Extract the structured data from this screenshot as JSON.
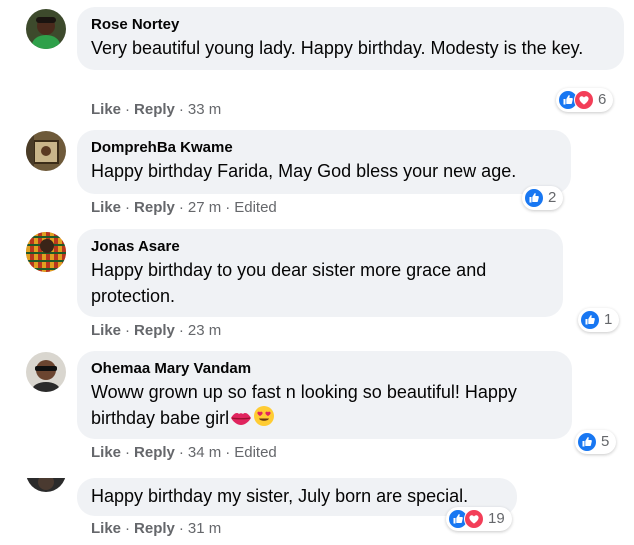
{
  "comments": [
    {
      "author": "Rose Nortey",
      "text": "Very beautiful young lady. Happy birthday. Modesty is the key.",
      "like_label": "Like",
      "reply_label": "Reply",
      "time": "33 m",
      "edited": "",
      "reaction_icons": [
        "like-icon",
        "love-icon"
      ],
      "reaction_count": "6"
    },
    {
      "author": "DomprehBa Kwame",
      "text": "Happy birthday Farida, May God bless your new age.",
      "like_label": "Like",
      "reply_label": "Reply",
      "time": "27 m",
      "edited": "Edited",
      "reaction_icons": [
        "like-icon"
      ],
      "reaction_count": "2"
    },
    {
      "author": "Jonas Asare",
      "text": "Happy birthday to you dear sister more grace and protection.",
      "like_label": "Like",
      "reply_label": "Reply",
      "time": "23 m",
      "edited": "",
      "reaction_icons": [
        "like-icon"
      ],
      "reaction_count": "1"
    },
    {
      "author": "Ohemaa Mary Vandam",
      "text": "Woww grown up so fast n looking so beautiful! Happy birthday babe girl",
      "text_emojis": [
        "lips-emoji",
        "heart-eyes-emoji"
      ],
      "like_label": "Like",
      "reply_label": "Reply",
      "time": "34 m",
      "edited": "Edited",
      "reaction_icons": [
        "like-icon"
      ],
      "reaction_count": "5"
    },
    {
      "author": "",
      "text": "Happy birthday my sister, July born are special.",
      "like_label": "Like",
      "reply_label": "Reply",
      "time": "31 m",
      "edited": "",
      "reaction_icons": [
        "like-icon",
        "love-icon"
      ],
      "reaction_count": "19"
    }
  ],
  "colors": {
    "bubble": "#f0f2f5",
    "meta_text": "#65676b",
    "like_blue": "#1877f2",
    "love_red": "#f33e58"
  }
}
